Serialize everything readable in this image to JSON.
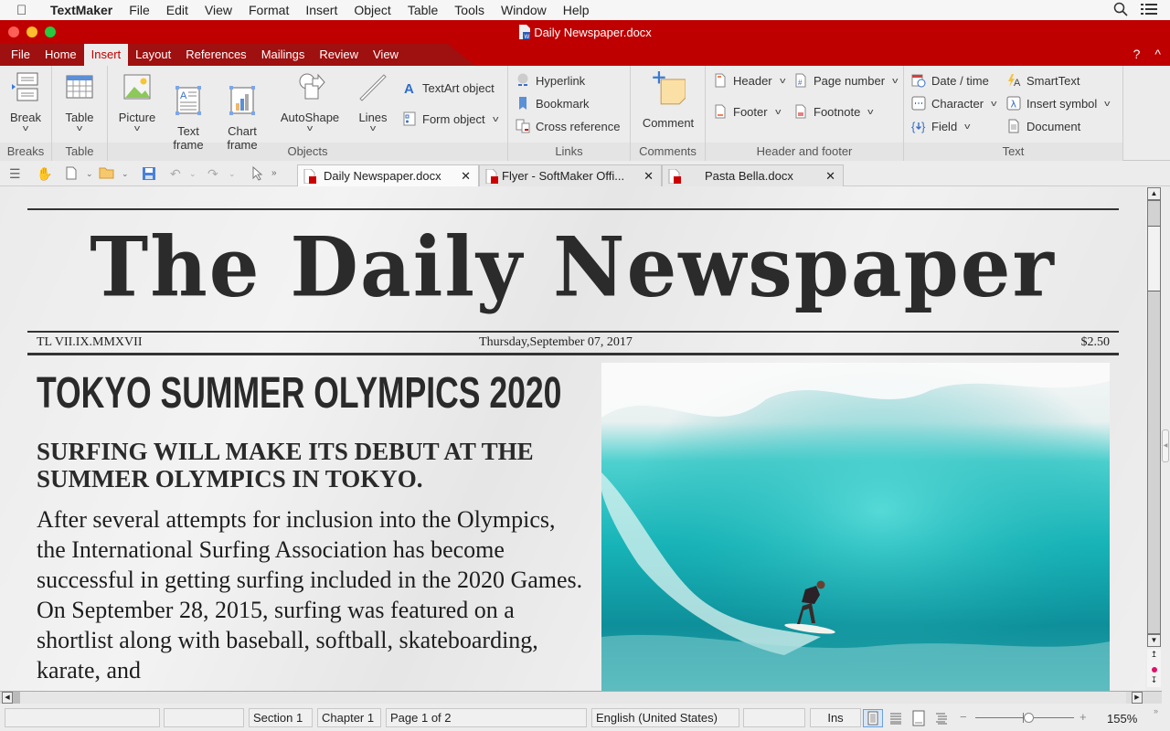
{
  "macmenu": {
    "app": "TextMaker",
    "items": [
      "File",
      "Edit",
      "View",
      "Format",
      "Insert",
      "Object",
      "Table",
      "Tools",
      "Window",
      "Help"
    ]
  },
  "window": {
    "title": "Daily Newspaper.docx",
    "accent": "#bf0000"
  },
  "ribbon_tabs": {
    "items": [
      "File",
      "Home",
      "Insert",
      "Layout",
      "References",
      "Mailings",
      "Review",
      "View"
    ],
    "active": "Insert",
    "help": "?",
    "collapse": "^"
  },
  "ribbon": {
    "groups": {
      "breaks": "Breaks",
      "table": "Table",
      "objects": "Objects",
      "links": "Links",
      "comments": "Comments",
      "header_footer": "Header and footer",
      "text": "Text"
    },
    "break": "Break",
    "table": "Table",
    "picture": "Picture",
    "text_frame": "Text\nframe",
    "chart_frame": "Chart\nframe",
    "autoshape": "AutoShape",
    "lines": "Lines",
    "textart": "TextArt object",
    "form_object": "Form object",
    "hyperlink": "Hyperlink",
    "bookmark": "Bookmark",
    "cross_reference": "Cross reference",
    "comment": "Comment",
    "header": "Header",
    "footer": "Footer",
    "page_number": "Page number",
    "footnote": "Footnote",
    "date_time": "Date / time",
    "smarttext": "SmartText",
    "character": "Character",
    "insert_symbol": "Insert symbol",
    "field": "Field",
    "document": "Document"
  },
  "doc_tabs": [
    {
      "label": "Daily Newspaper.docx",
      "active": true
    },
    {
      "label": "Flyer - SoftMaker Offi...",
      "active": false
    },
    {
      "label": "Pasta Bella.docx",
      "active": false
    }
  ],
  "document": {
    "masthead": "The Daily Newspaper",
    "edition": "TL VII.IX.MMXVII",
    "date": "Thursday,September 07, 2017",
    "price": "$2.50",
    "headline": "TOKYO SUMMER OLYMPICS 2020",
    "subhead": "SURFING WILL MAKE ITS DEBUT AT THE SUMMER OLYMPICS IN TOKYO.",
    "body": "After several attempts for inclusion into the Olympics, the International Surfing Association has become successful in getting surfing included in the 2020 Games. On September 28, 2015, surfing was featured on a shortlist along with baseball, softball, skateboarding, karate, and",
    "photo_alt": "Surfer riding a large turquoise wave"
  },
  "status": {
    "field1": "",
    "field2": "",
    "section": "Section 1",
    "chapter": "Chapter 1",
    "page": "Page 1 of 2",
    "language": "English (United States)",
    "field3": "",
    "mode": "Ins",
    "zoom_minus": "−",
    "zoom_plus": "+",
    "zoom": "155%",
    "zoom_level_fraction": 0.55
  }
}
